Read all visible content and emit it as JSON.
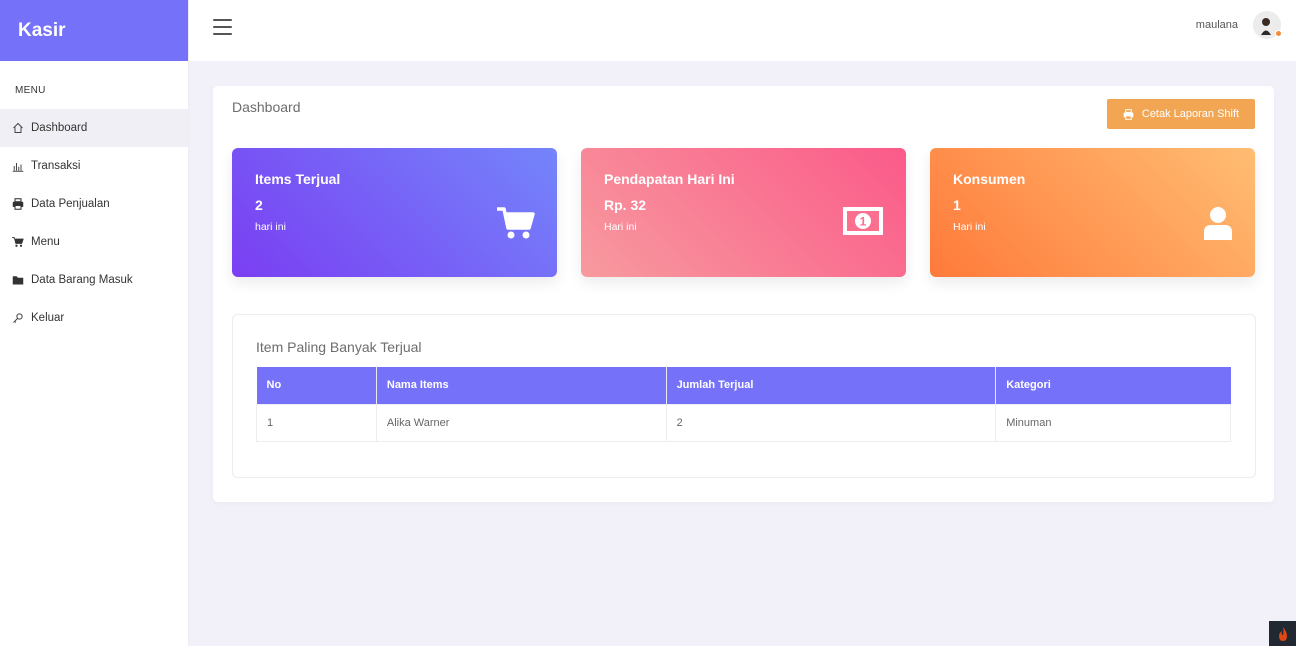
{
  "app": {
    "brand": "Kasir"
  },
  "sidebar": {
    "heading": "MENU",
    "items": [
      {
        "label": "Dashboard",
        "icon": "home-icon"
      },
      {
        "label": "Transaksi",
        "icon": "bar-chart-icon"
      },
      {
        "label": "Data Penjualan",
        "icon": "printer-icon"
      },
      {
        "label": "Menu",
        "icon": "cart-icon"
      },
      {
        "label": "Data Barang Masuk",
        "icon": "folder-icon"
      },
      {
        "label": "Keluar",
        "icon": "key-icon"
      }
    ]
  },
  "header": {
    "username": "maulana",
    "menu_icon": "hamburger-icon"
  },
  "main": {
    "title": "Dashboard",
    "print_button": "Cetak Laporan Shift",
    "stats": [
      {
        "title": "Items Terjual",
        "value": "2",
        "sub": "hari ini",
        "icon": "shopping-cart-icon"
      },
      {
        "title": "Pendapatan Hari Ini",
        "value": "Rp. 32",
        "sub": "Hari ini",
        "icon": "money-icon"
      },
      {
        "title": "Konsumen",
        "value": "1",
        "sub": "Hari ini",
        "icon": "user-icon"
      }
    ],
    "table": {
      "title": "Item Paling Banyak Terjual",
      "headers": [
        "No",
        "Nama Items",
        "Jumlah Terjual",
        "Kategori"
      ],
      "rows": [
        [
          "1",
          "Alika Warner",
          "2",
          "Minuman"
        ]
      ]
    }
  },
  "colors": {
    "accent": "#7571f9",
    "button": "#f2a654"
  }
}
